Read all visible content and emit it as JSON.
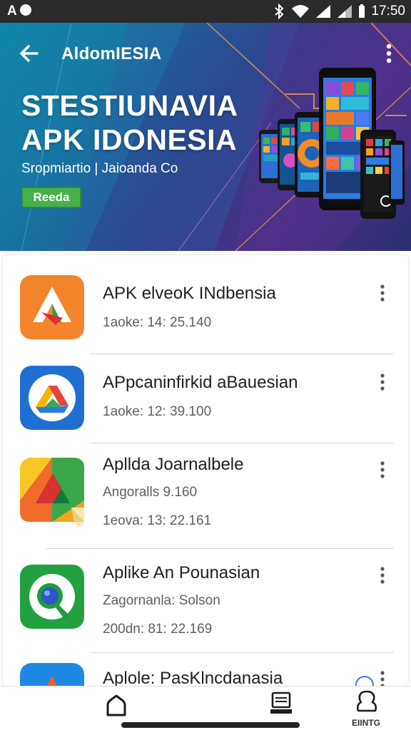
{
  "status_bar": {
    "left_text": "A",
    "time": "17:50"
  },
  "header": {
    "app_title": "AldomIESIA",
    "headline_line1": "STESTIUNAVIA",
    "headline_line2": "APK IDONESIA",
    "subtitle": "Sropmiartio | Jaioanda Co",
    "badge": "Reeda"
  },
  "apps": [
    {
      "title": "APK elveoK INdbensia",
      "meta1": "1aoke: 14: 25.140",
      "meta2": "",
      "icon": "orange-a-logo-icon"
    },
    {
      "title": "APpcaninfirkid aBauesian",
      "meta1": "1aoke: 12: 39.100",
      "meta2": "",
      "icon": "blue-drive-logo-icon"
    },
    {
      "title": "Apllda Joarnalbele",
      "meta1": "Angoralls 9.160",
      "meta2": "1eova: 13: 22.161",
      "icon": "colorful-triangle-logo-icon"
    },
    {
      "title": "Aplike An Pounasian",
      "meta1": "Zagornanla: Solson",
      "meta2": "200dn: 81: 22.169",
      "icon": "green-lens-logo-icon"
    },
    {
      "title": "Aplole: PasKlncdanasia",
      "meta1": "",
      "meta2": "",
      "icon": "blue-a-logo-icon"
    }
  ],
  "bottom_nav": {
    "account_label": "EIINTG"
  },
  "colors": {
    "hero_start": "#0e7ea3",
    "hero_end": "#4a2f86",
    "badge": "#48b04a"
  }
}
